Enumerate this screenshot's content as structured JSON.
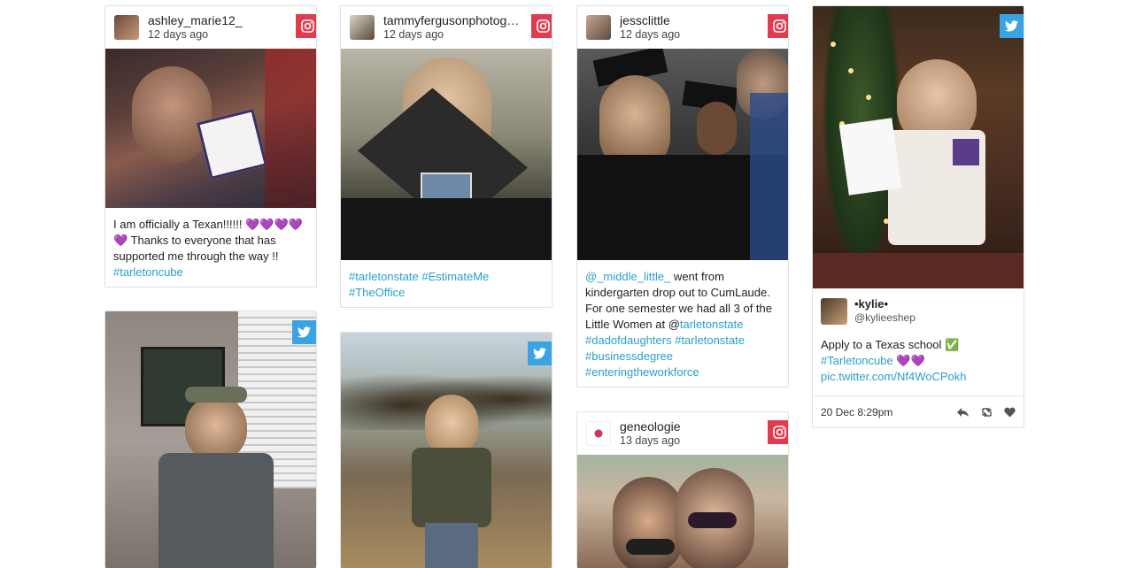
{
  "posts": [
    {
      "network": "instagram",
      "username": "ashley_marie12_",
      "time": "12 days ago",
      "caption_parts": [
        {
          "text": "I am officially a Texan!!!!!! 💜💜💜💜💜 Thanks to everyone that has supported me through the way !! "
        },
        {
          "text": "#tarletoncube",
          "link": true
        }
      ]
    },
    {
      "network": "instagram",
      "username": "tammyfergusonphotog…",
      "time": "12 days ago",
      "caption_parts": [
        {
          "text": "#tarletonstate",
          "link": true
        },
        {
          "text": " "
        },
        {
          "text": "#EstimateMe",
          "link": true
        },
        {
          "text": " "
        },
        {
          "text": "#TheOffice",
          "link": true
        }
      ]
    },
    {
      "network": "instagram",
      "username": "jessclittle",
      "time": "12 days ago",
      "caption_parts": [
        {
          "text": "@_middle_little_",
          "link": true
        },
        {
          "text": " went from kindergarten drop out to CumLaude. For one semester we had all 3 of the Little Women at @"
        },
        {
          "text": "tarletonstate",
          "link": true
        },
        {
          "text": " "
        },
        {
          "text": "#dadofdaughters",
          "link": true
        },
        {
          "text": " "
        },
        {
          "text": "#tarletonstate",
          "link": true
        },
        {
          "text": " "
        },
        {
          "text": "#businessdegree",
          "link": true
        },
        {
          "text": " "
        },
        {
          "text": "#enteringtheworkforce",
          "link": true
        }
      ]
    },
    {
      "network": "twitter",
      "name": "•kylie•",
      "handle": "@kylieeshep",
      "caption_parts": [
        {
          "text": "Apply to a Texas school ✅ "
        },
        {
          "text": "#Tarletoncube",
          "link": true
        },
        {
          "text": " 💜💜 "
        },
        {
          "text": "pic.twitter.com/Nf4WoCPokh",
          "link": true
        }
      ],
      "date": "20 Dec 8:29pm",
      "actions": [
        "reply-icon",
        "retweet-icon",
        "like-icon"
      ]
    },
    {
      "network": "twitter"
    },
    {
      "network": "twitter"
    },
    {
      "network": "instagram",
      "username": "geneologie",
      "time": "13 days ago"
    }
  ],
  "colors": {
    "instagram": "#e33b4e",
    "twitter": "#3aa3e3",
    "link": "#2a9fc9"
  }
}
